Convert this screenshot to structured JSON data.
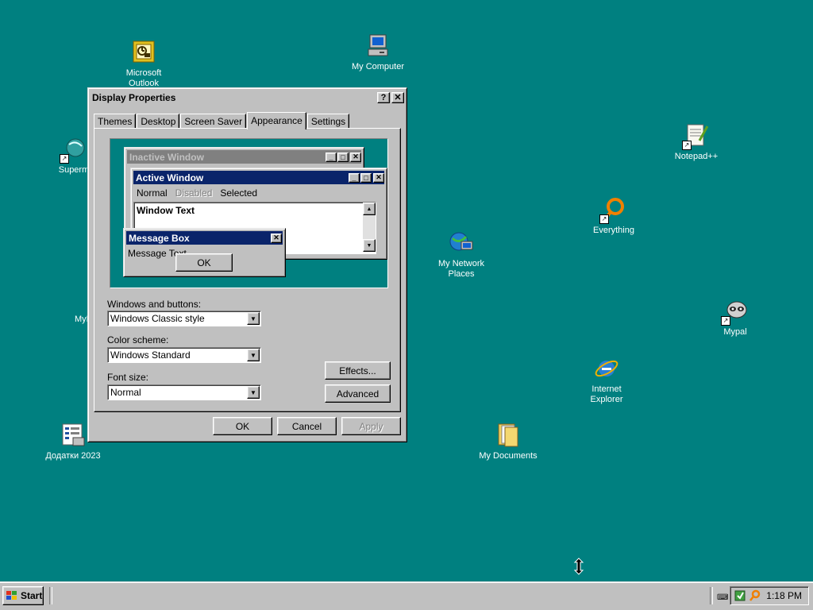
{
  "desktop_icons": [
    {
      "label": "Microsoft\nOutlook"
    },
    {
      "label": "My Computer"
    },
    {
      "label": "Superm"
    },
    {
      "label": "Notepad++"
    },
    {
      "label": "Everything"
    },
    {
      "label": "My Network\nPlaces"
    },
    {
      "label": "MyP"
    },
    {
      "label": "Mypal"
    },
    {
      "label": "Internet\nExplorer"
    },
    {
      "label": "Додатки 2023"
    },
    {
      "label": "My Documents"
    }
  ],
  "dialog": {
    "title": "Display Properties",
    "help_label": "?",
    "close_label": "✕",
    "tabs": [
      "Themes",
      "Desktop",
      "Screen Saver",
      "Appearance",
      "Settings"
    ],
    "active_tab": "Appearance",
    "preview": {
      "inactive_title": "Inactive Window",
      "active_title": "Active Window",
      "menu": {
        "normal": "Normal",
        "disabled": "Disabled",
        "selected": "Selected"
      },
      "window_text": "Window Text",
      "msgbox_title": "Message Box",
      "msgbox_text": "Message Text",
      "msgbox_ok": "OK"
    },
    "windows_buttons": {
      "label": "Windows and buttons:",
      "value": "Windows Classic style"
    },
    "color_scheme": {
      "label": "Color scheme:",
      "value": "Windows Standard"
    },
    "font_size": {
      "label": "Font size:",
      "value": "Normal"
    },
    "effects_label": "Effects...",
    "advanced_label": "Advanced",
    "ok_label": "OK",
    "cancel_label": "Cancel",
    "apply_label": "Apply"
  },
  "taskbar": {
    "start_label": "Start",
    "clock": "1:18 PM"
  },
  "colors": {
    "desktop": "#008080",
    "active_title": "#0a246a",
    "inactive_title": "#808080",
    "face": "#c0c0c0"
  }
}
